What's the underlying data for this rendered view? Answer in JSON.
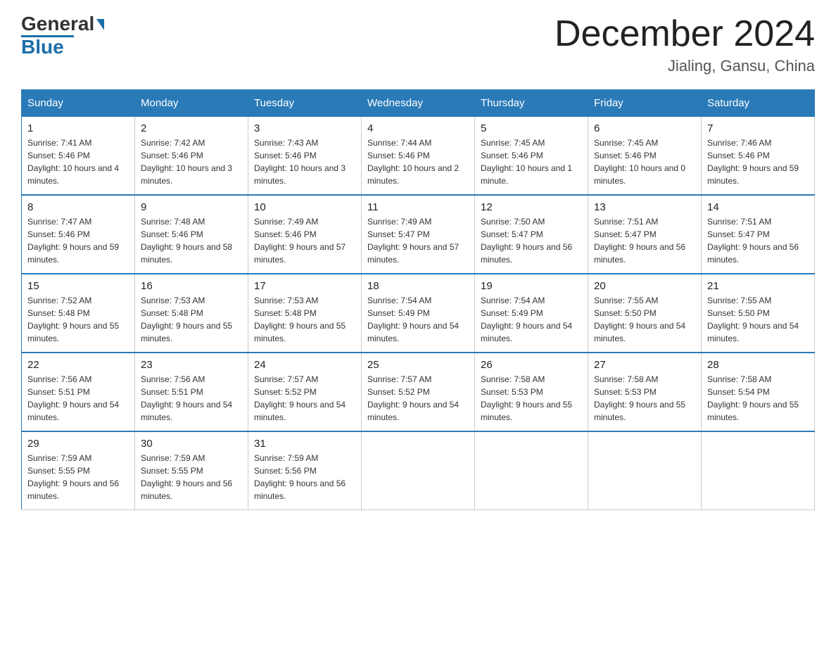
{
  "header": {
    "logo": {
      "general": "General",
      "blue": "Blue"
    },
    "title": "December 2024",
    "location": "Jialing, Gansu, China"
  },
  "days_of_week": [
    "Sunday",
    "Monday",
    "Tuesday",
    "Wednesday",
    "Thursday",
    "Friday",
    "Saturday"
  ],
  "weeks": [
    [
      {
        "day": "1",
        "sunrise": "7:41 AM",
        "sunset": "5:46 PM",
        "daylight": "10 hours and 4 minutes."
      },
      {
        "day": "2",
        "sunrise": "7:42 AM",
        "sunset": "5:46 PM",
        "daylight": "10 hours and 3 minutes."
      },
      {
        "day": "3",
        "sunrise": "7:43 AM",
        "sunset": "5:46 PM",
        "daylight": "10 hours and 3 minutes."
      },
      {
        "day": "4",
        "sunrise": "7:44 AM",
        "sunset": "5:46 PM",
        "daylight": "10 hours and 2 minutes."
      },
      {
        "day": "5",
        "sunrise": "7:45 AM",
        "sunset": "5:46 PM",
        "daylight": "10 hours and 1 minute."
      },
      {
        "day": "6",
        "sunrise": "7:45 AM",
        "sunset": "5:46 PM",
        "daylight": "10 hours and 0 minutes."
      },
      {
        "day": "7",
        "sunrise": "7:46 AM",
        "sunset": "5:46 PM",
        "daylight": "9 hours and 59 minutes."
      }
    ],
    [
      {
        "day": "8",
        "sunrise": "7:47 AM",
        "sunset": "5:46 PM",
        "daylight": "9 hours and 59 minutes."
      },
      {
        "day": "9",
        "sunrise": "7:48 AM",
        "sunset": "5:46 PM",
        "daylight": "9 hours and 58 minutes."
      },
      {
        "day": "10",
        "sunrise": "7:49 AM",
        "sunset": "5:46 PM",
        "daylight": "9 hours and 57 minutes."
      },
      {
        "day": "11",
        "sunrise": "7:49 AM",
        "sunset": "5:47 PM",
        "daylight": "9 hours and 57 minutes."
      },
      {
        "day": "12",
        "sunrise": "7:50 AM",
        "sunset": "5:47 PM",
        "daylight": "9 hours and 56 minutes."
      },
      {
        "day": "13",
        "sunrise": "7:51 AM",
        "sunset": "5:47 PM",
        "daylight": "9 hours and 56 minutes."
      },
      {
        "day": "14",
        "sunrise": "7:51 AM",
        "sunset": "5:47 PM",
        "daylight": "9 hours and 56 minutes."
      }
    ],
    [
      {
        "day": "15",
        "sunrise": "7:52 AM",
        "sunset": "5:48 PM",
        "daylight": "9 hours and 55 minutes."
      },
      {
        "day": "16",
        "sunrise": "7:53 AM",
        "sunset": "5:48 PM",
        "daylight": "9 hours and 55 minutes."
      },
      {
        "day": "17",
        "sunrise": "7:53 AM",
        "sunset": "5:48 PM",
        "daylight": "9 hours and 55 minutes."
      },
      {
        "day": "18",
        "sunrise": "7:54 AM",
        "sunset": "5:49 PM",
        "daylight": "9 hours and 54 minutes."
      },
      {
        "day": "19",
        "sunrise": "7:54 AM",
        "sunset": "5:49 PM",
        "daylight": "9 hours and 54 minutes."
      },
      {
        "day": "20",
        "sunrise": "7:55 AM",
        "sunset": "5:50 PM",
        "daylight": "9 hours and 54 minutes."
      },
      {
        "day": "21",
        "sunrise": "7:55 AM",
        "sunset": "5:50 PM",
        "daylight": "9 hours and 54 minutes."
      }
    ],
    [
      {
        "day": "22",
        "sunrise": "7:56 AM",
        "sunset": "5:51 PM",
        "daylight": "9 hours and 54 minutes."
      },
      {
        "day": "23",
        "sunrise": "7:56 AM",
        "sunset": "5:51 PM",
        "daylight": "9 hours and 54 minutes."
      },
      {
        "day": "24",
        "sunrise": "7:57 AM",
        "sunset": "5:52 PM",
        "daylight": "9 hours and 54 minutes."
      },
      {
        "day": "25",
        "sunrise": "7:57 AM",
        "sunset": "5:52 PM",
        "daylight": "9 hours and 54 minutes."
      },
      {
        "day": "26",
        "sunrise": "7:58 AM",
        "sunset": "5:53 PM",
        "daylight": "9 hours and 55 minutes."
      },
      {
        "day": "27",
        "sunrise": "7:58 AM",
        "sunset": "5:53 PM",
        "daylight": "9 hours and 55 minutes."
      },
      {
        "day": "28",
        "sunrise": "7:58 AM",
        "sunset": "5:54 PM",
        "daylight": "9 hours and 55 minutes."
      }
    ],
    [
      {
        "day": "29",
        "sunrise": "7:59 AM",
        "sunset": "5:55 PM",
        "daylight": "9 hours and 56 minutes."
      },
      {
        "day": "30",
        "sunrise": "7:59 AM",
        "sunset": "5:55 PM",
        "daylight": "9 hours and 56 minutes."
      },
      {
        "day": "31",
        "sunrise": "7:59 AM",
        "sunset": "5:56 PM",
        "daylight": "9 hours and 56 minutes."
      },
      null,
      null,
      null,
      null
    ]
  ],
  "labels": {
    "sunrise": "Sunrise:",
    "sunset": "Sunset:",
    "daylight": "Daylight:"
  }
}
